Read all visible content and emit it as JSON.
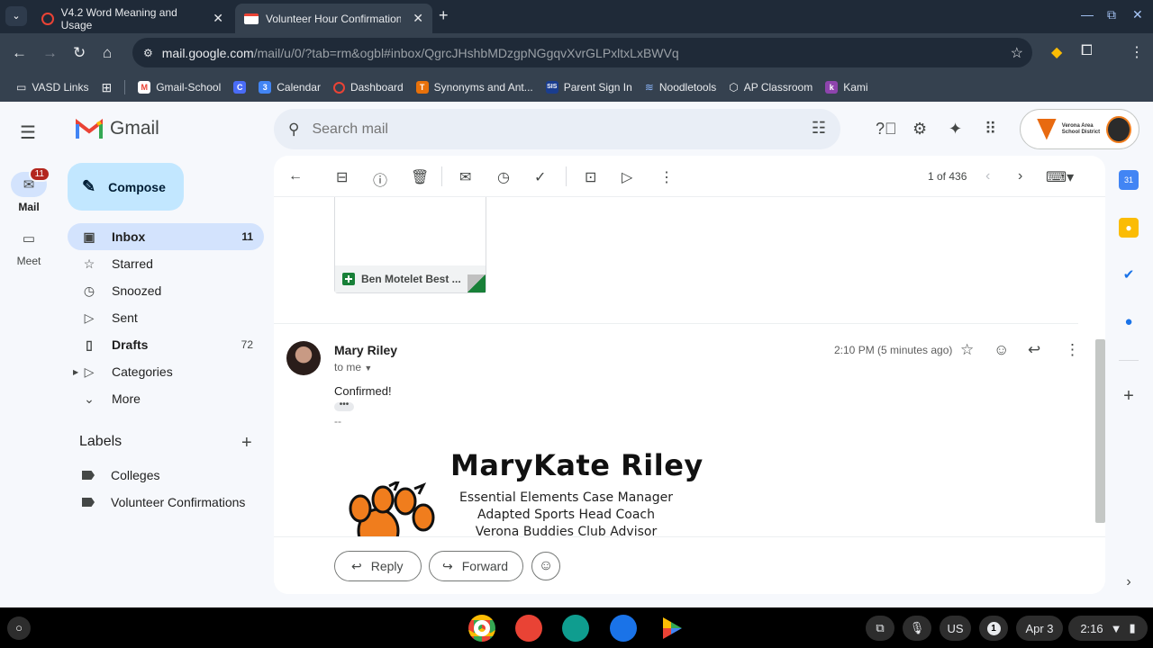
{
  "browser": {
    "tabs": [
      {
        "title": "V4.2 Word Meaning and Usage",
        "active": false
      },
      {
        "title": "Volunteer Hour Confirmation -",
        "active": true
      }
    ],
    "url_host": "mail.google.com",
    "url_path": "/mail/u/0/?tab=rm&ogbl#inbox/QgrcJHshbMDzgpNGgqvXvrGLPxltxLxBWVq",
    "bookmarks": [
      "VASD Links",
      "Gmail-School",
      "Calendar",
      "Dashboard",
      "Synonyms and Ant...",
      "Parent Sign In",
      "Noodletools",
      "AP Classroom",
      "Kami"
    ]
  },
  "gmail": {
    "app_name": "Gmail",
    "rail": {
      "mail_label": "Mail",
      "mail_badge": "11",
      "meet_label": "Meet"
    },
    "search_placeholder": "Search mail",
    "account_label": "Verona Area School District",
    "compose_label": "Compose",
    "nav": [
      {
        "label": "Inbox",
        "count": "11"
      },
      {
        "label": "Starred",
        "count": ""
      },
      {
        "label": "Snoozed",
        "count": ""
      },
      {
        "label": "Sent",
        "count": ""
      },
      {
        "label": "Drafts",
        "count": "72"
      },
      {
        "label": "Categories",
        "count": ""
      },
      {
        "label": "More",
        "count": ""
      }
    ],
    "labels_heading": "Labels",
    "labels": [
      "Colleges",
      "Volunteer Confirmations"
    ],
    "pager": "1 of 436"
  },
  "message": {
    "attachment_name": "Ben Motelet Best ...",
    "sender": "Mary Riley",
    "to": "to me",
    "time": "2:10 PM (5 minutes ago)",
    "body": "Confirmed!",
    "sig_dash": "--",
    "signature": {
      "name": "MaryKate Riley",
      "lines": [
        "Essential Elements Case Manager",
        "Adapted Sports Head Coach",
        "Verona Buddies Club Advisor"
      ]
    },
    "reply_label": "Reply",
    "forward_label": "Forward"
  },
  "shelf": {
    "locale": "US",
    "notifications": "1",
    "date": "Apr 3",
    "time": "2:16"
  },
  "colors": {
    "accent_blue": "#0b57d0",
    "compose_bg": "#c2e7ff",
    "inbox_active": "#d3e3fd",
    "badge_red": "#b3261e",
    "sheets_green": "#188038",
    "school_orange": "#e86a10"
  }
}
